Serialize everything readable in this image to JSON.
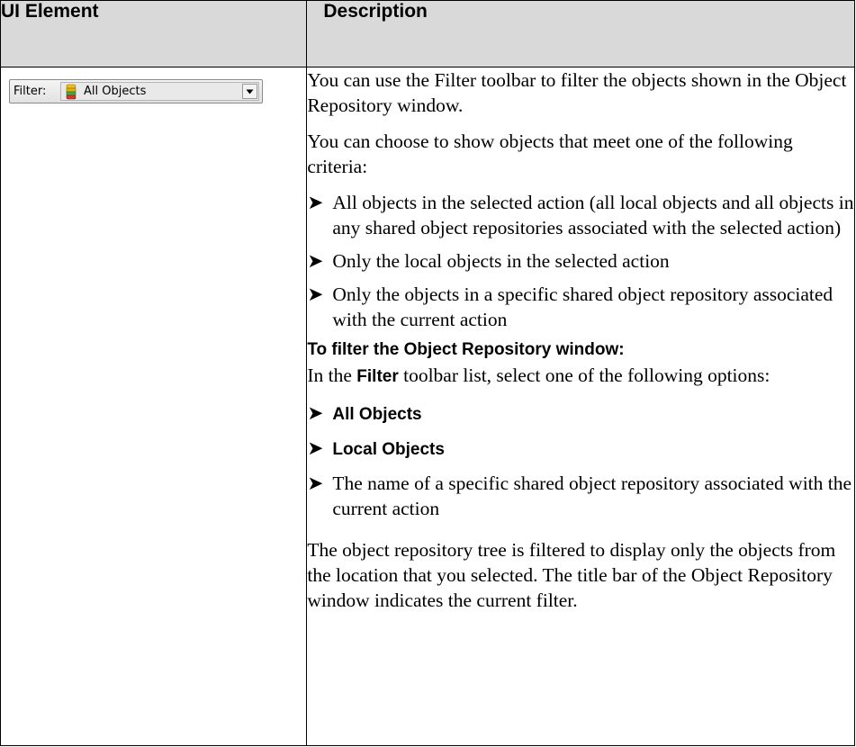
{
  "table": {
    "headers": [
      "UI Element",
      "Description"
    ]
  },
  "filter_widget": {
    "label": "Filter:",
    "selected_value": "All Objects",
    "icon": "object-repository-icon"
  },
  "description": {
    "intro": "You can use the Filter toolbar to filter the objects shown in the Object Repository window.",
    "criteria_intro": "You can choose to show objects that meet one of the following criteria:",
    "criteria": [
      "All objects in the selected action (all local objects and all objects in any shared object repositories associated with the selected action)",
      "Only the local objects in the selected action",
      "Only the objects in a specific shared object repository associated with the current action"
    ],
    "procedure_title": "To filter the Object Repository window:",
    "procedure_text_before": "In the ",
    "procedure_text_bold": "Filter",
    "procedure_text_after": " toolbar list, select one of the following options:",
    "options": [
      {
        "text": "All Objects",
        "bold": true
      },
      {
        "text": "Local Objects",
        "bold": true
      },
      {
        "text": "The name of a specific shared object repository associated with the current action",
        "bold": false
      }
    ],
    "result": "The object repository tree is filtered to display only the objects from the location that you selected. The title bar of the Object Repository window indicates the current filter."
  },
  "bullet_glyph": "➤"
}
